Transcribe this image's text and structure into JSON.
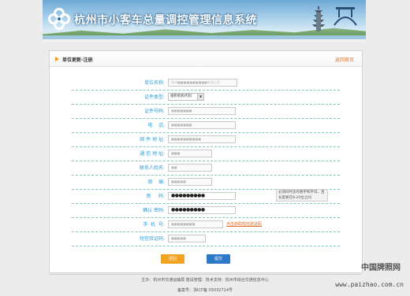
{
  "banner": {
    "title": "杭州市小客车总量调控管理信息系统"
  },
  "panel": {
    "title": "单位更新-注册",
    "back_link": "返回首页"
  },
  "form": {
    "rows": [
      {
        "label": "单位名称:",
        "value": "杭州■■■■■■■■■■有限公司"
      },
      {
        "label": "证件类型:",
        "select_value": "组织机构代码"
      },
      {
        "label": "证件号码:",
        "value": "■■■■■■■"
      },
      {
        "label": "电    话:",
        "value": "■■■■■■■"
      },
      {
        "label": "邮 件 地 址:",
        "value": "■■■■■■■■■■"
      },
      {
        "label": "通 信 地 址:",
        "value": "■■■"
      },
      {
        "label": "联系人姓名:",
        "value": "■■"
      },
      {
        "label": "邮    编:",
        "value": "■■■■■"
      },
      {
        "label": "密     码:",
        "value": "●●●●●●●●●",
        "hint": "必须同时含有数字和字母，且长度要在8-20位之间"
      },
      {
        "label": "确认 密码:",
        "value": "●●●●●●●●●"
      },
      {
        "label": "手  机  号:",
        "value": "■■■■■■■■",
        "link": "点击获取短信验证码"
      },
      {
        "label": "短信验证码:",
        "value": "■■■■■"
      }
    ]
  },
  "buttons": {
    "back": "返回",
    "submit": "提交"
  },
  "footer": {
    "line1": "主办：杭州市交通运输局    建设管理：技术支持：杭州市综合交通信息中心",
    "line2": "备案号：浙ICP备 05032714号"
  },
  "watermark": {
    "line1": "中国牌照网",
    "line2": "www.paizhao.com.cn"
  }
}
